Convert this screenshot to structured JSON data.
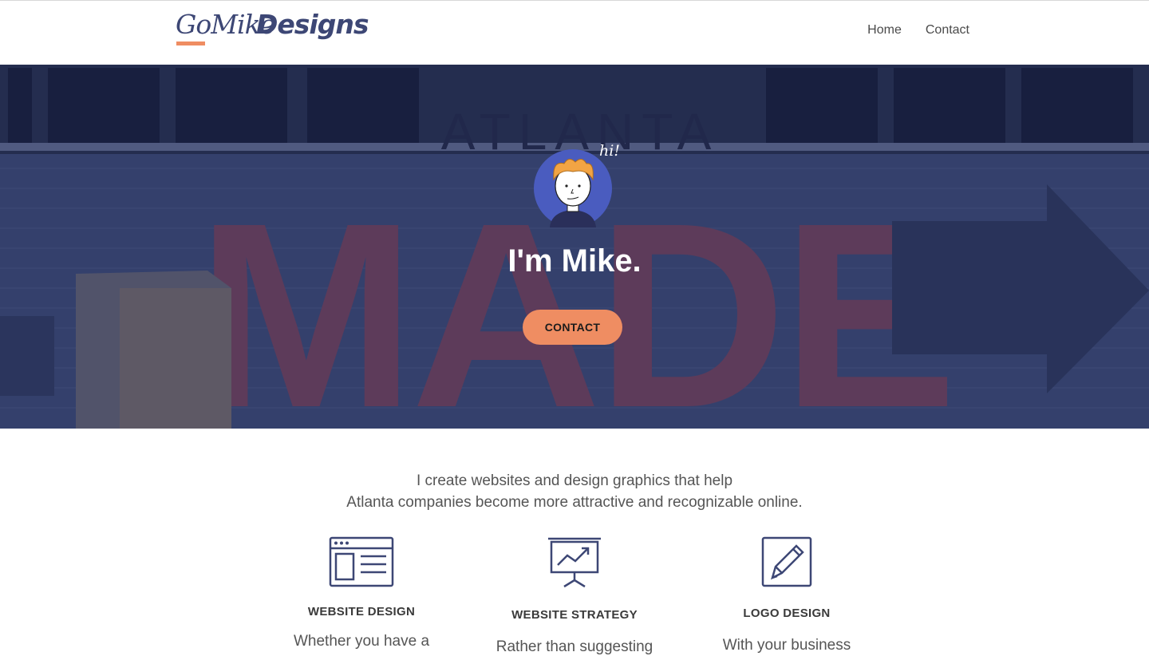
{
  "header": {
    "logo_part1": "GoMike",
    "logo_part2": "Designs",
    "nav": [
      {
        "label": "Home"
      },
      {
        "label": "Contact"
      }
    ]
  },
  "hero": {
    "background_text_top": "ATLANTA",
    "background_text_main": "MADE",
    "avatar_greeting": "hi!",
    "title": "I'm Mike.",
    "cta_label": "CONTACT"
  },
  "intro": {
    "line1": "I create websites and design graphics that help",
    "line2": "Atlanta companies become more attractive and recognizable online."
  },
  "services": [
    {
      "icon": "browser-window-icon",
      "title": "WEBSITE DESIGN",
      "text": "Whether you have a"
    },
    {
      "icon": "presentation-chart-icon",
      "title": "WEBSITE STRATEGY",
      "text": "Rather than suggesting"
    },
    {
      "icon": "pencil-square-icon",
      "title": "LOGO DESIGN",
      "text": "With your business"
    }
  ],
  "colors": {
    "accent": "#ef8d62",
    "brand": "#3d4775",
    "hero_overlay": "#33406b"
  }
}
